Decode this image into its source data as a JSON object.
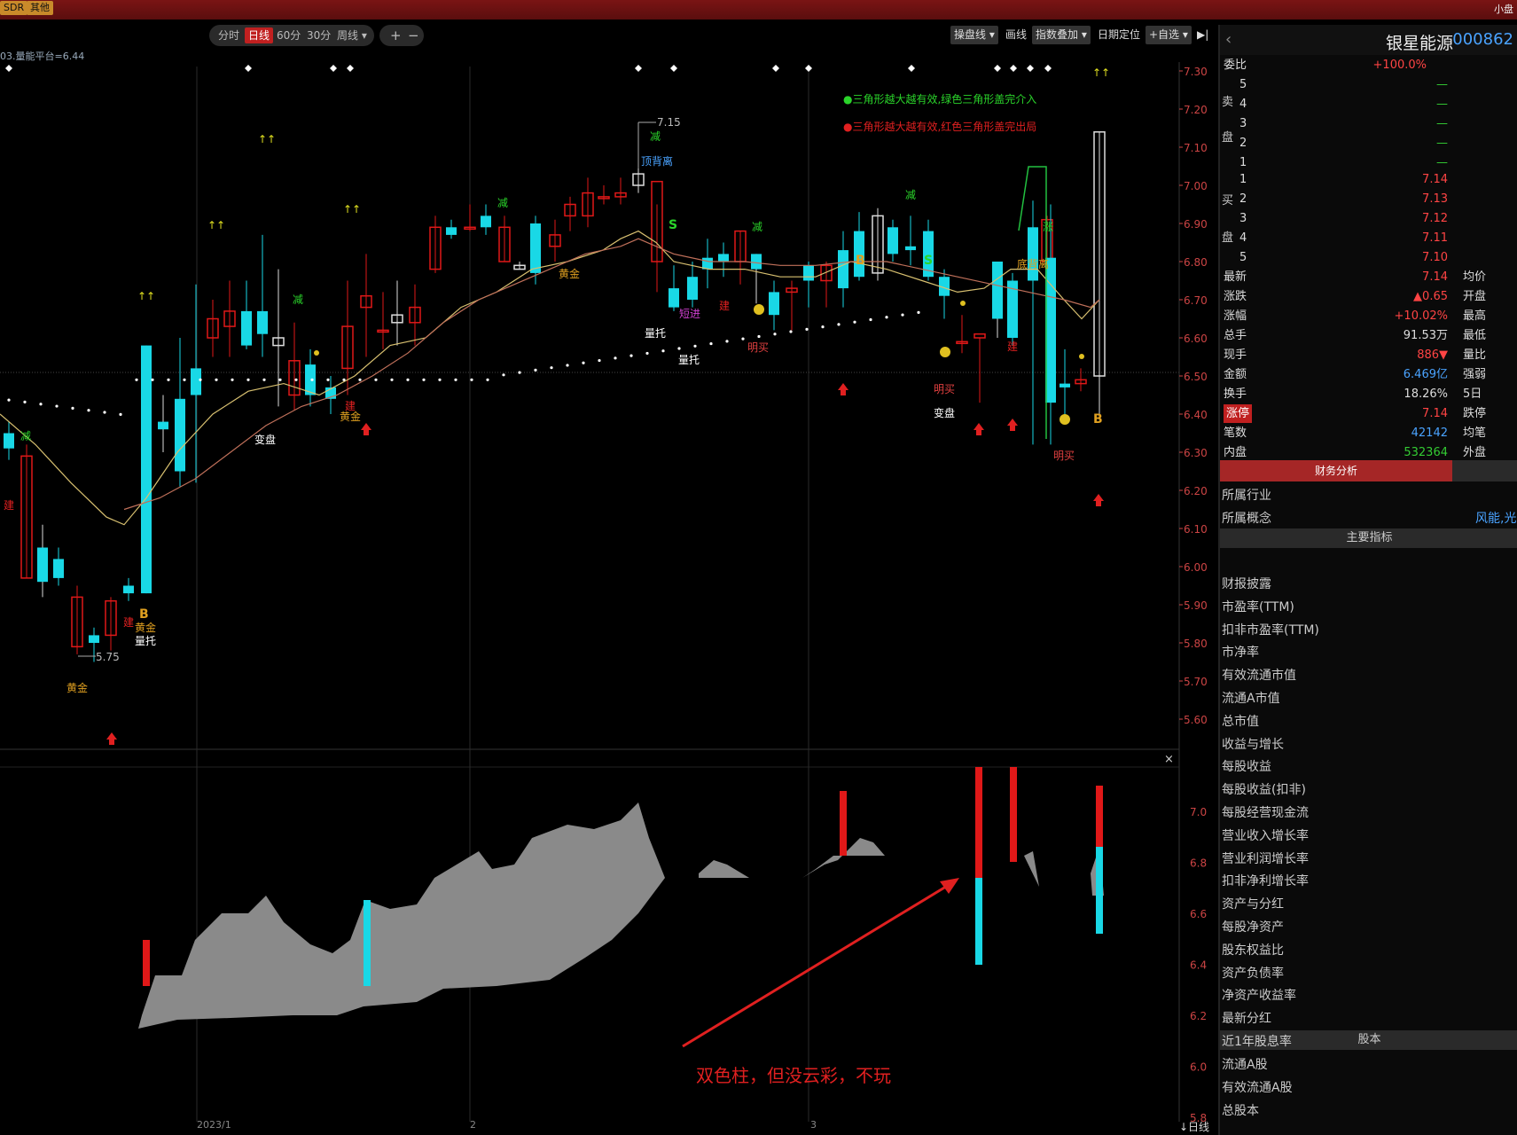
{
  "topbar": {
    "tag1": "SDR",
    "tag2": "其他",
    "right": "小盘"
  },
  "toolbar": {
    "periods": [
      "分时",
      "日线",
      "60分",
      "30分",
      "周线 ▾"
    ],
    "active_index": 1,
    "zoom_in": "+",
    "zoom_out": "−",
    "right_buttons": [
      "操盘线 ▾",
      "画线",
      "指数叠加 ▾",
      "日期定位",
      "+自选 ▾"
    ],
    "collapse": "▶|"
  },
  "indicator_title": "03.量能平台=6.44",
  "price_axis": [
    "7.30",
    "7.20",
    "7.10",
    "7.00",
    "6.90",
    "6.80",
    "6.70",
    "6.60",
    "6.50",
    "6.40",
    "6.30",
    "6.20",
    "6.10",
    "6.00",
    "5.90",
    "5.80",
    "5.70",
    "5.60"
  ],
  "lower_axis": [
    "7.0",
    "6.8",
    "6.6",
    "6.4",
    "6.2",
    "6.0",
    "5.8"
  ],
  "chart_annotations": {
    "legend_green": "●三角形越大越有效,绿色三角形盖完介入",
    "legend_red": "●三角形越大越有效,红色三角形盖完出局",
    "high_label": "7.15",
    "low_label": "5.75",
    "signals": [
      "黄金",
      "黄金",
      "黄金",
      "量托",
      "量托",
      "量托",
      "变盘",
      "变盘",
      "明买",
      "明买",
      "明买",
      "建",
      "建",
      "建",
      "建",
      "建",
      "减",
      "减",
      "减",
      "减",
      "减",
      "减",
      "顶背离",
      "短进",
      "S",
      "S",
      "B",
      "B",
      "B",
      "↑↑",
      "↑↑",
      "↑↑",
      "↑↑",
      "↑↑",
      "底背离",
      "涨"
    ],
    "note": "双色柱，但没云彩，不玩"
  },
  "dates": [
    "2023/1",
    "2",
    "3"
  ],
  "period_label": "↓日线",
  "stock": {
    "name": "银星能源",
    "code": "000862"
  },
  "quote": {
    "weibi_label": "委比",
    "weibi": "+100.0%",
    "sell_label": "卖盘",
    "buy_label": "买盘",
    "sell": [
      {
        "lv": "5",
        "p": "—"
      },
      {
        "lv": "4",
        "p": "—"
      },
      {
        "lv": "3",
        "p": "—"
      },
      {
        "lv": "2",
        "p": "—"
      },
      {
        "lv": "1",
        "p": "—"
      }
    ],
    "buy": [
      {
        "lv": "1",
        "p": "7.14"
      },
      {
        "lv": "2",
        "p": "7.13"
      },
      {
        "lv": "3",
        "p": "7.12"
      },
      {
        "lv": "4",
        "p": "7.11"
      },
      {
        "lv": "5",
        "p": "7.10"
      }
    ],
    "stats": [
      {
        "l": "最新",
        "v": "7.14",
        "r": "均价"
      },
      {
        "l": "涨跌",
        "v": "▲0.65",
        "r": "开盘"
      },
      {
        "l": "涨幅",
        "v": "+10.02%",
        "r": "最高"
      },
      {
        "l": "总手",
        "v": "91.53万",
        "r": "最低"
      },
      {
        "l": "现手",
        "v": "886▼",
        "r": "量比"
      },
      {
        "l": "金额",
        "v": "6.469亿",
        "r": "强弱"
      },
      {
        "l": "换手",
        "v": "18.26%",
        "r": "5日"
      },
      {
        "l": "涨停",
        "v": "7.14",
        "r": "跌停"
      },
      {
        "l": "笔数",
        "v": "42142",
        "r": "均笔"
      },
      {
        "l": "内盘",
        "v": "532364",
        "r": "外盘"
      }
    ]
  },
  "finance": {
    "tab": "财务分析",
    "industry_label": "所属行业",
    "concept_label": "所属概念",
    "concept_value": "风能,光伏",
    "section1": "主要指标",
    "items1": [
      "财报披露",
      "市盈率(TTM)",
      "扣非市盈率(TTM)",
      "市净率",
      "有效流通市值",
      "流通A市值",
      "总市值",
      "收益与增长",
      "每股收益",
      "每股收益(扣非)",
      "每股经营现金流",
      "营业收入增长率",
      "营业利润增长率",
      "扣非净利增长率",
      "资产与分红",
      "每股净资产",
      "股东权益比",
      "资产负债率",
      "净资产收益率",
      "最新分红",
      "近1年股息率"
    ],
    "section2": "股本",
    "items2": [
      "流通A股",
      "有效流通A股",
      "总股本"
    ]
  },
  "colors": {
    "up": "#e01818",
    "down": "#19d8e6",
    "ma1": "#d8c070",
    "ma2": "#c0705a",
    "cloud": "#8a8a8a"
  }
}
